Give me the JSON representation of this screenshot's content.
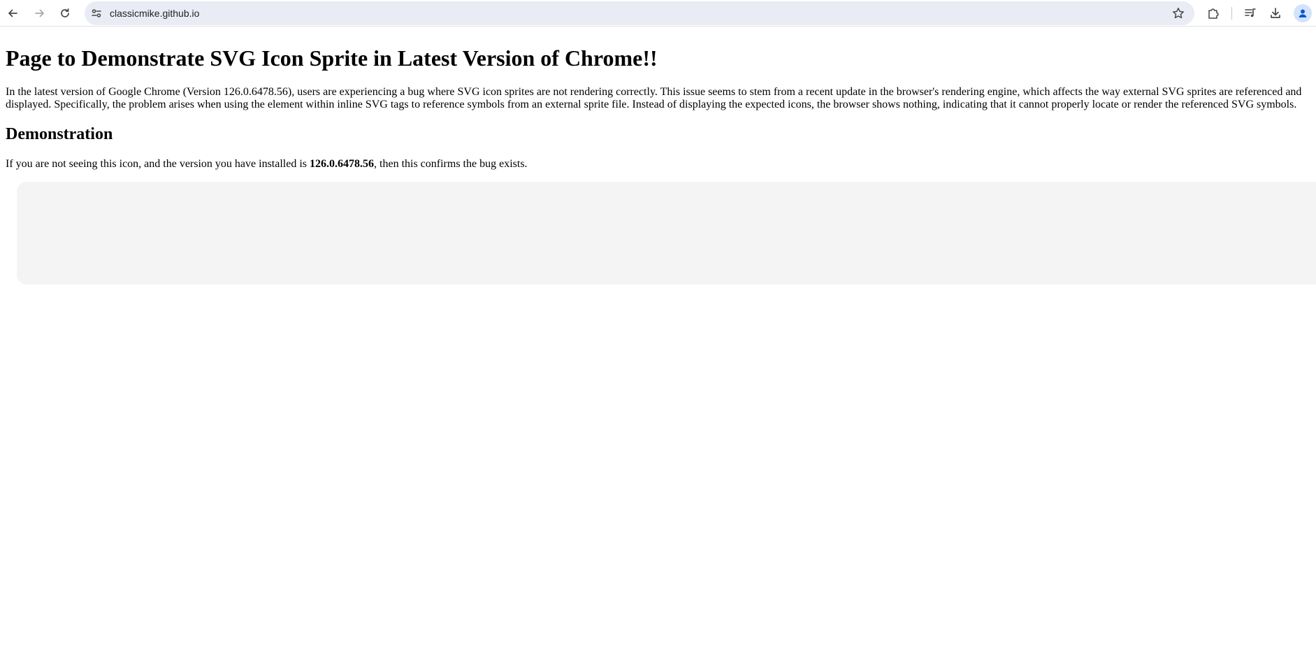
{
  "browser": {
    "url": "classicmike.github.io"
  },
  "page": {
    "title": "Page to Demonstrate SVG Icon Sprite in Latest Version of Chrome!!",
    "intro": "In the latest version of Google Chrome (Version 126.0.6478.56), users are experiencing a bug where SVG icon sprites are not rendering correctly. This issue seems to stem from a recent update in the browser's rendering engine, which affects the way external SVG sprites are referenced and displayed. Specifically, the problem arises when using the element within inline SVG tags to reference symbols from an external sprite file. Instead of displaying the expected icons, the browser shows nothing, indicating that it cannot properly locate or render the referenced SVG symbols.",
    "section_heading": "Demonstration",
    "demo_prefix": "If you are not seeing this icon, and the version you have installed is ",
    "demo_version": "126.0.6478.56",
    "demo_suffix": ", then this confirms the bug exists."
  }
}
